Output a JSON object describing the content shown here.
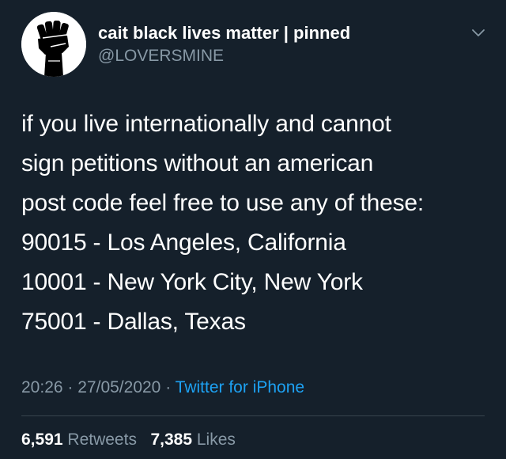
{
  "author": {
    "display_name": "cait black lives matter | pinned",
    "handle": "@LOVERSMINE",
    "avatar_icon": "raised-fist-icon"
  },
  "menu": {
    "icon": "chevron-down-icon"
  },
  "tweet": {
    "lines": [
      "if you live internationally and cannot",
      "sign petitions without an american",
      "post code feel free to use any of these:",
      "90015 - Los Angeles, California",
      "10001 - New York City, New York",
      "75001 - Dallas, Texas"
    ]
  },
  "meta": {
    "time": "20:26",
    "date": "27/05/2020",
    "separator": "·",
    "source": "Twitter for iPhone"
  },
  "stats": {
    "retweets_count": "6,591",
    "retweets_label": "Retweets",
    "likes_count": "7,385",
    "likes_label": "Likes"
  },
  "colors": {
    "background": "#15202b",
    "text": "#ffffff",
    "secondary_text": "#8899a6",
    "link": "#1da1f2",
    "divider": "#38444d"
  }
}
